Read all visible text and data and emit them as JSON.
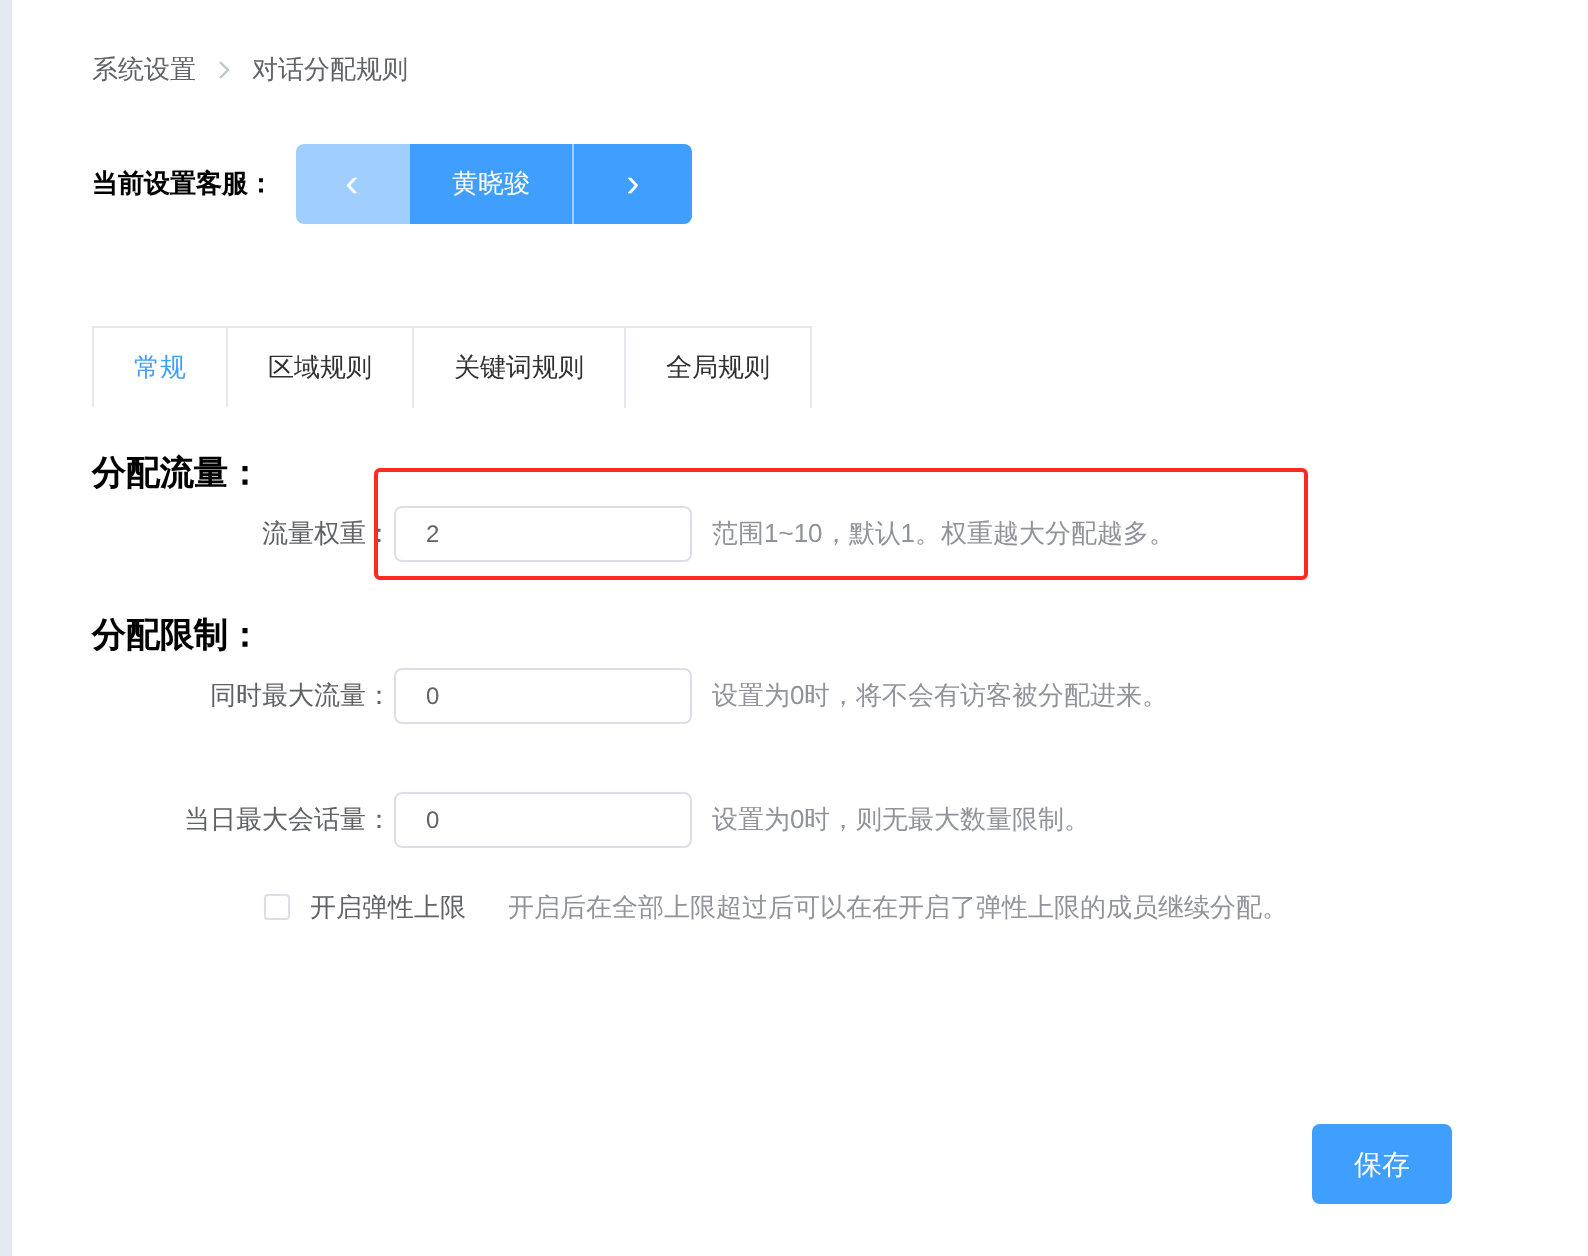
{
  "breadcrumb": [
    {
      "label": "系统设置"
    },
    {
      "label": "对话分配规则"
    }
  ],
  "agent_selector": {
    "label": "当前设置客服：",
    "prev": {
      "label": "‹",
      "disabled": true
    },
    "name": "黄晓骏",
    "next": {
      "label": "›",
      "disabled": false
    }
  },
  "tabs": [
    {
      "label": "常规",
      "selected": true
    },
    {
      "label": "区域规则",
      "selected": false
    },
    {
      "label": "关键词规则",
      "selected": false
    },
    {
      "label": "全局规则",
      "selected": false
    }
  ],
  "sections": [
    {
      "title": "分配流量：",
      "highlighted": true,
      "rows": [
        {
          "kind": "input",
          "label": "流量权重：",
          "value": "2",
          "hint": "范围1~10，默认1。权重越大分配越多。"
        }
      ]
    },
    {
      "title": "分配限制：",
      "highlighted": false,
      "rows": [
        {
          "kind": "input",
          "label": "同时最大流量：",
          "value": "0",
          "hint": "设置为0时，将不会有访客被分配进来。"
        },
        {
          "kind": "input",
          "label": "当日最大会话量：",
          "value": "0",
          "hint": "设置为0时，则无最大数量限制。"
        },
        {
          "kind": "checkbox",
          "label": "开启弹性上限",
          "checked": false,
          "hint": "开启后在全部上限超过后可以在在开启了弹性上限的成员继续分配。"
        }
      ]
    }
  ],
  "save_button": "保存"
}
